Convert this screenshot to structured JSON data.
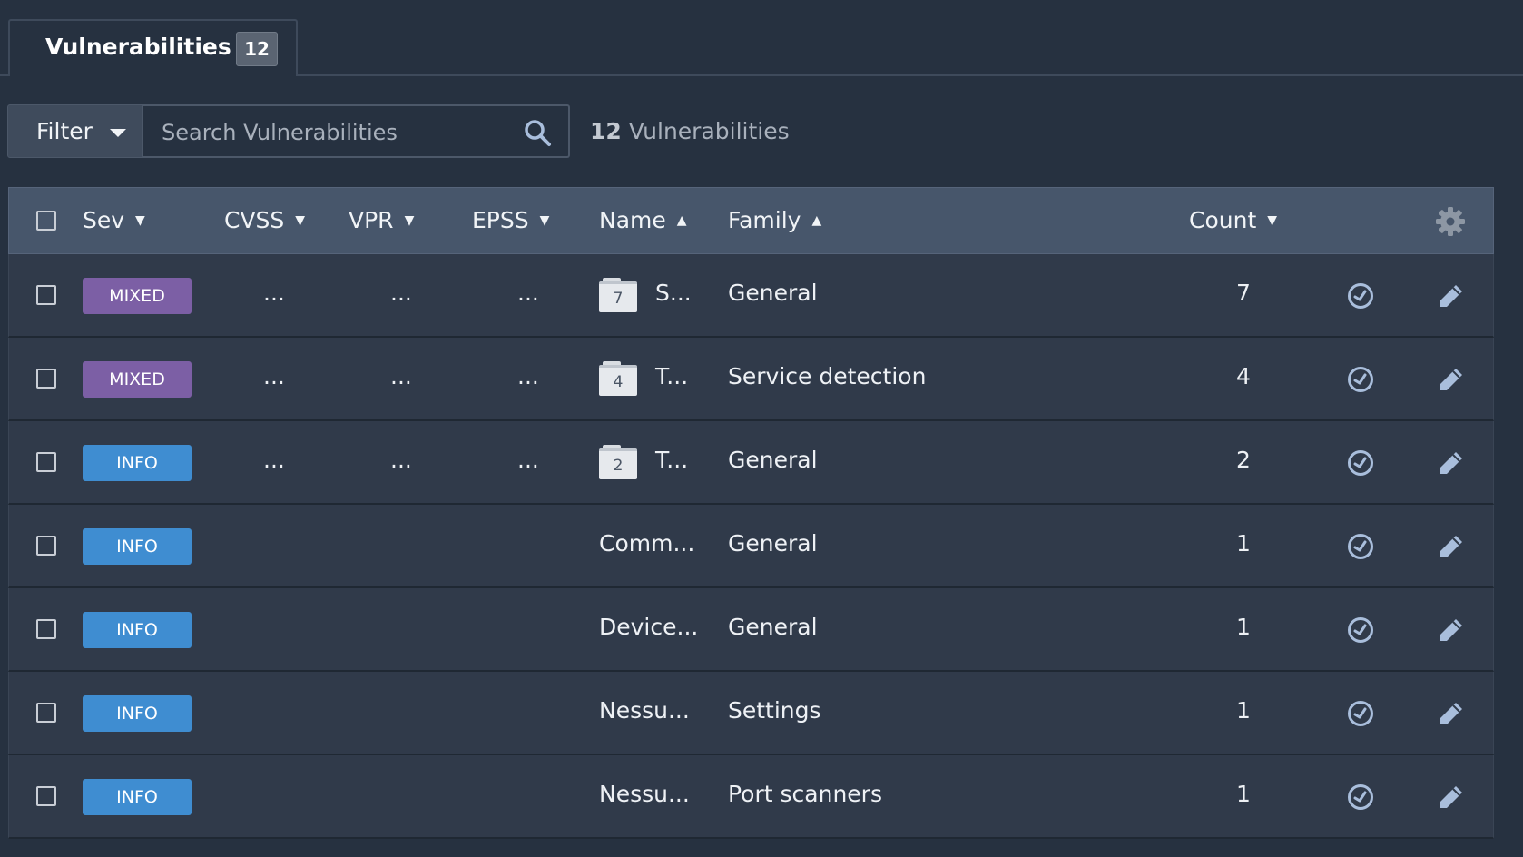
{
  "tab": {
    "label": "Vulnerabilities",
    "badge": "12"
  },
  "toolbar": {
    "filter_label": "Filter",
    "search_placeholder": "Search Vulnerabilities",
    "search_value": "",
    "count_number": "12",
    "count_text": "Vulnerabilities"
  },
  "table": {
    "columns": {
      "sev": "Sev",
      "cvss": "CVSS",
      "vpr": "VPR",
      "epss": "EPSS",
      "name": "Name",
      "family": "Family",
      "count": "Count"
    },
    "rows": [
      {
        "sev": "MIXED",
        "cvss": "...",
        "vpr": "...",
        "epss": "...",
        "group_count": "7",
        "name": "S...",
        "family": "General",
        "count": "7"
      },
      {
        "sev": "MIXED",
        "cvss": "...",
        "vpr": "...",
        "epss": "...",
        "group_count": "4",
        "name": "T...",
        "family": "Service detection",
        "count": "4"
      },
      {
        "sev": "INFO",
        "cvss": "...",
        "vpr": "...",
        "epss": "...",
        "group_count": "2",
        "name": "T...",
        "family": "General",
        "count": "2"
      },
      {
        "sev": "INFO",
        "cvss": "",
        "vpr": "",
        "epss": "",
        "group_count": "",
        "name": "Comm...",
        "family": "General",
        "count": "1"
      },
      {
        "sev": "INFO",
        "cvss": "",
        "vpr": "",
        "epss": "",
        "group_count": "",
        "name": "Device...",
        "family": "General",
        "count": "1"
      },
      {
        "sev": "INFO",
        "cvss": "",
        "vpr": "",
        "epss": "",
        "group_count": "",
        "name": "Nessu...",
        "family": "Settings",
        "count": "1"
      },
      {
        "sev": "INFO",
        "cvss": "",
        "vpr": "",
        "epss": "",
        "group_count": "",
        "name": "Nessu...",
        "family": "Port scanners",
        "count": "1"
      }
    ]
  },
  "colors": {
    "background": "#263140",
    "header": "#47566b",
    "row": "#303a4a",
    "mixed": "#7c5fa5",
    "info": "#3f8dd1",
    "icon": "#a9bedc"
  },
  "icons": {
    "search": "search-icon",
    "gear": "gear-icon",
    "history": "history-icon",
    "edit": "pencil-icon",
    "folder": "folder-icon"
  }
}
